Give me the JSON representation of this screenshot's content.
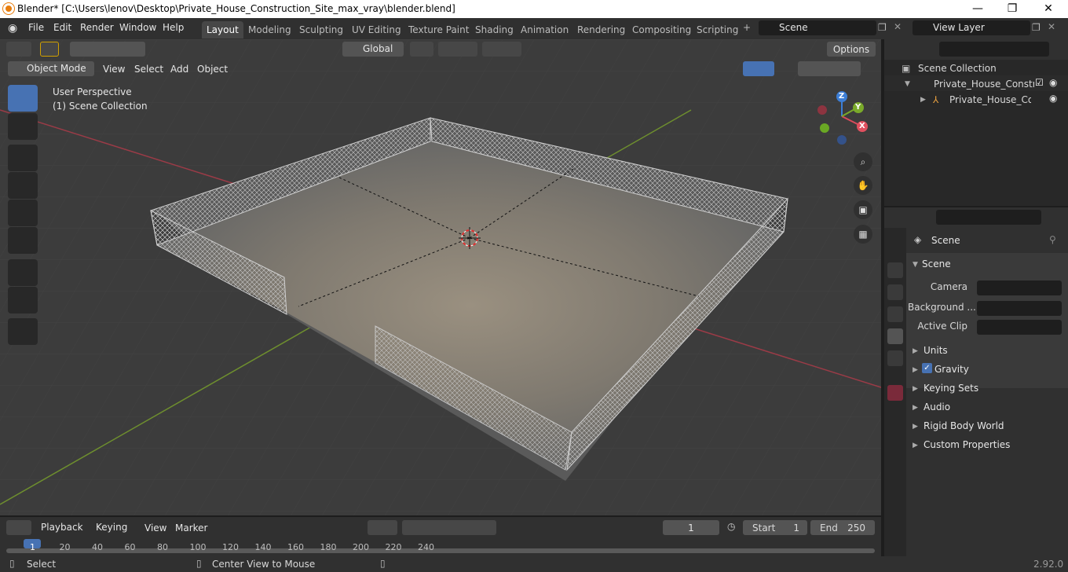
{
  "window": {
    "title": "Blender* [C:\\Users\\lenov\\Desktop\\Private_House_Construction_Site_max_vray\\blender.blend]",
    "minimize": "—",
    "maximize": "❐",
    "close": "✕"
  },
  "menu": [
    "File",
    "Edit",
    "Render",
    "Window",
    "Help"
  ],
  "workspaces": [
    "Layout",
    "Modeling",
    "Sculpting",
    "UV Editing",
    "Texture Paint",
    "Shading",
    "Animation",
    "Rendering",
    "Compositing",
    "Scripting"
  ],
  "scene_field": "Scene",
  "viewlayer_field": "View Layer",
  "viewport_header": {
    "mode": "Object Mode",
    "menus": [
      "View",
      "Select",
      "Add",
      "Object"
    ],
    "transform": "Global",
    "options": "Options"
  },
  "overlay": {
    "perspective": "User Perspective",
    "collection": "(1) Scene Collection"
  },
  "gizmo": {
    "z": "Z",
    "y": "Y",
    "x": "X"
  },
  "outliner": {
    "root": "Scene Collection",
    "items": [
      "Private_House_Construct",
      "Private_House_Const"
    ]
  },
  "properties": {
    "header": "Scene",
    "panel": "Scene",
    "camera_label": "Camera",
    "background_label": "Background ...",
    "clip_label": "Active Clip",
    "sections": [
      "Units",
      "Gravity",
      "Keying Sets",
      "Audio",
      "Rigid Body World",
      "Custom Properties"
    ]
  },
  "timeline": {
    "menus": [
      "Playback",
      "Keying",
      "View",
      "Marker"
    ],
    "current_frame": "1",
    "start_label": "Start",
    "start": "1",
    "end_label": "End",
    "end": "250",
    "ticks": [
      "1",
      "20",
      "40",
      "60",
      "80",
      "100",
      "120",
      "140",
      "160",
      "180",
      "200",
      "220",
      "240"
    ]
  },
  "status": {
    "select": "Select",
    "center": "Center View to Mouse",
    "version": "2.92.0"
  },
  "colors": {
    "accent": "#4772b3",
    "active_tab": "#474747"
  }
}
